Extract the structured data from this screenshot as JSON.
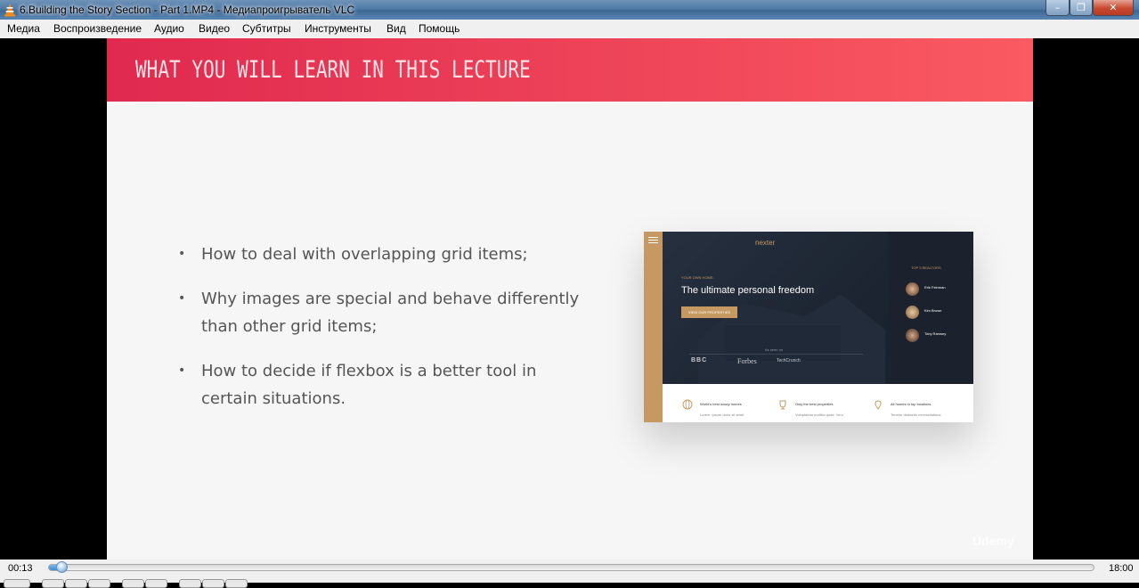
{
  "window": {
    "title": "6.Building the Story Section - Part 1.MP4 - Медиапроигрыватель VLC",
    "app_icon": "vlc-cone-icon",
    "minimize_icon": "minimize-icon",
    "maximize_icon": "restore-icon",
    "close_icon": "close-icon",
    "close_glyph": "✕",
    "minimize_glyph": "–",
    "maximize_glyph": "❐"
  },
  "menu": {
    "items": [
      "Медиа",
      "Воспроизведение",
      "Аудио",
      "Видео",
      "Субтитры",
      "Инструменты",
      "Вид",
      "Помощь"
    ]
  },
  "slide": {
    "title": "WHAT YOU WILL LEARN IN THIS LECTURE",
    "bullet_glyph": "•",
    "bullets": [
      "How to deal with overlapping grid items;",
      "Why images are special and behave differently than other grid items;",
      "How to decide if flexbox is a better tool in certain situations."
    ],
    "mockup": {
      "logo": "nexter",
      "eyebrow": "YOUR OWN HOME:",
      "headline": "The ultimate personal freedom",
      "cta": "VIEW OUR PROPERTIES",
      "seen_on": "As seen on",
      "press": [
        "BBC",
        "Forbes",
        "TechCrunch"
      ],
      "realtors_title": "TOP 3 REALTORS",
      "realtors": [
        "Erik Feinman",
        "Kim Brown",
        "Toby Ramsey"
      ],
      "features": [
        {
          "title": "World's best luxury homes",
          "text": "Lorem, ipsum dolor sit amet"
        },
        {
          "title": "Only the best properties",
          "text": "Voluptatum mollitia quae. Vero"
        },
        {
          "title": "All homes in top locations",
          "text": "Tenetur distinctio necessitatibus"
        }
      ]
    },
    "watermark": "Udemy",
    "colors": {
      "header_start": "#e0294f",
      "header_end": "#fa5a61",
      "accent": "#c69963"
    }
  },
  "player": {
    "time_current": "00:13",
    "time_total": "18:00",
    "progress_fraction": 0.012
  }
}
